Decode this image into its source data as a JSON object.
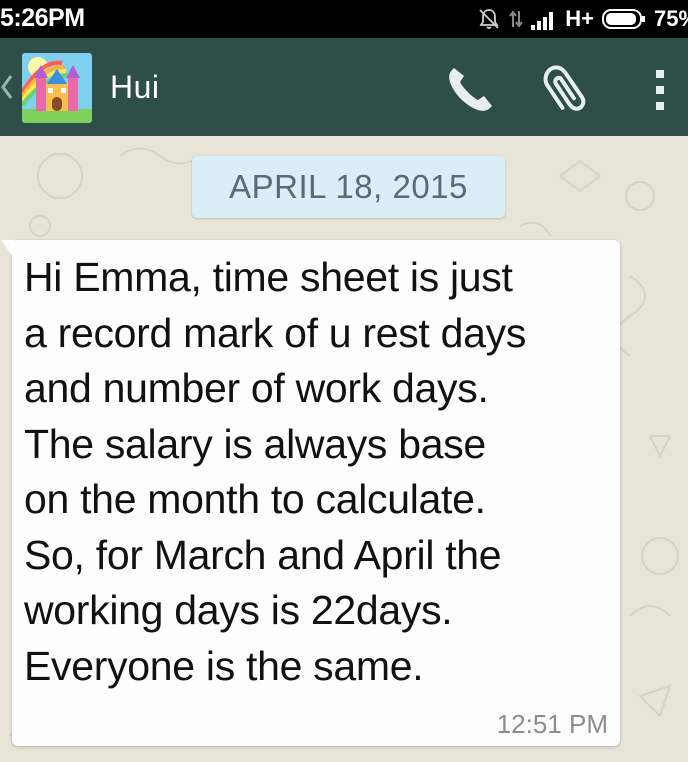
{
  "status_bar": {
    "time": "5:26PM",
    "network": "H+",
    "battery": "75%",
    "icons": [
      "mute-icon",
      "data-arrows-icon",
      "signal-icon",
      "battery-icon"
    ]
  },
  "header": {
    "contact_name": "Hui",
    "icons": [
      "back-icon",
      "avatar",
      "phone-icon",
      "paperclip-icon",
      "overflow-menu-icon"
    ],
    "colors": {
      "background": "#2e4e4a",
      "text": "#ffffff"
    }
  },
  "chat": {
    "date_divider": "APRIL 18, 2015",
    "messages": [
      {
        "direction": "incoming",
        "lines": [
          "Hi Emma, time sheet is just",
          "a record mark of u rest days",
          "and number of work days.",
          "The salary is always base",
          "on the month to calculate.",
          "So, for March and April the",
          "working days is 22days.",
          "Everyone is the same."
        ],
        "time": "12:51 PM"
      }
    ],
    "colors": {
      "date_chip": "#d9eef5",
      "bubble": "#fdfdfd",
      "wallpaper": "#e8e4d8"
    }
  }
}
